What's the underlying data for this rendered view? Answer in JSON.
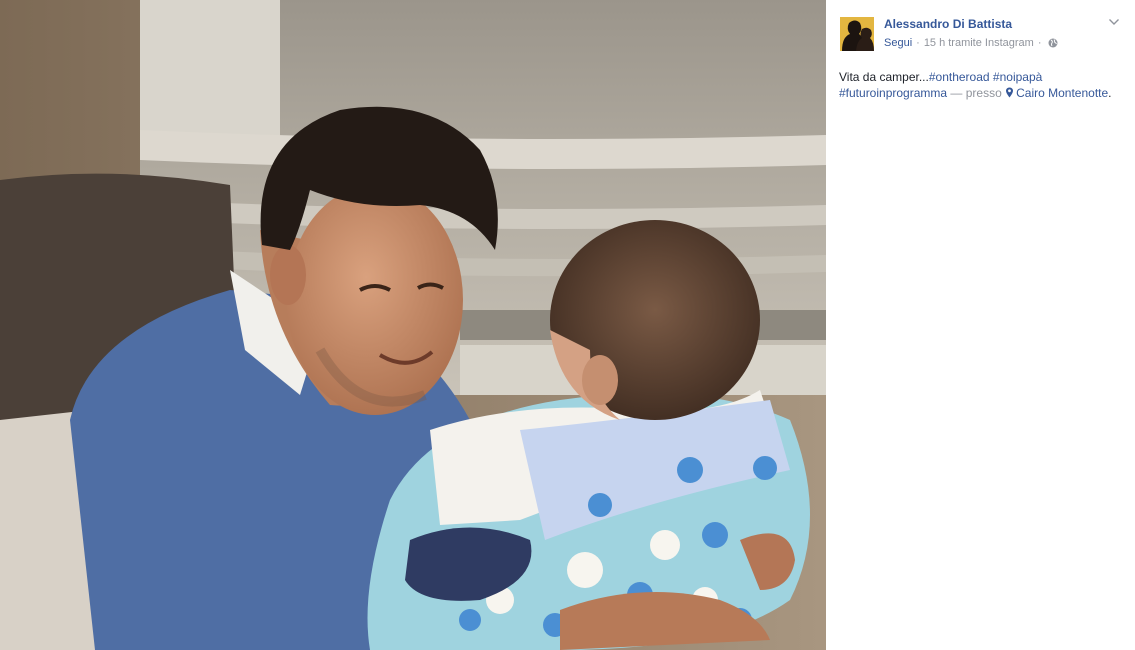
{
  "photo": {
    "icon": "photo-image",
    "accent_sweater": "#4f6ea4",
    "accent_blanket": "#9fd3df"
  },
  "post": {
    "author": "Alessandro Di Battista",
    "follow_label": "Segui",
    "dot_separator": "·",
    "time": "15 h",
    "via": "tramite Instagram",
    "audience_icon": "globe-icon",
    "menu_icon": "chevron-down-icon",
    "text_prefix": "Vita da camper...",
    "hashtags": [
      "#ontheroad",
      "#noipapà",
      "#futuroinprogramma"
    ],
    "presso": "— presso",
    "location_icon": "map-pin-icon",
    "location": "Cairo Montenotte",
    "location_suffix": "."
  },
  "colors": {
    "link": "#365899",
    "muted": "#90949c",
    "text": "#1d2129"
  }
}
